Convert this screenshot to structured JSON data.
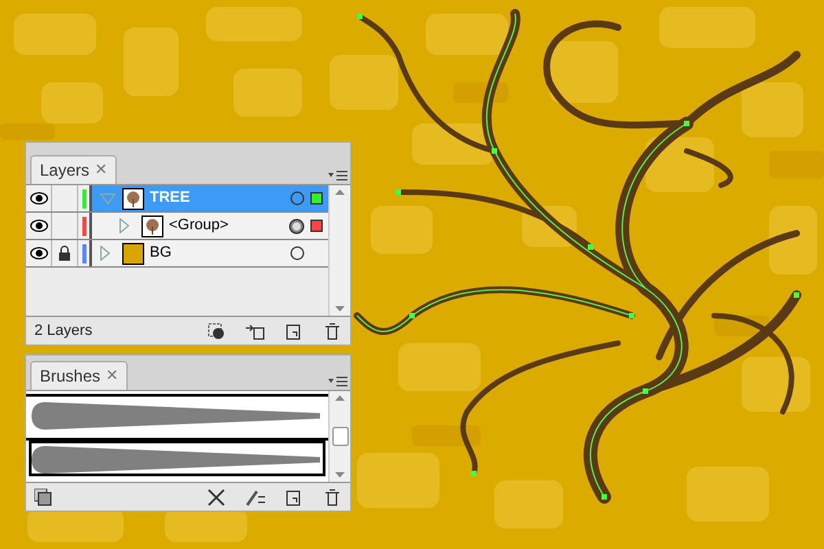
{
  "layers_panel": {
    "tab": "Layers",
    "tab_close": "✕",
    "layers": [
      {
        "name": "TREE",
        "visible": true,
        "locked": false,
        "color": "#33ee33",
        "selected": true,
        "expanded": true,
        "children": [
          {
            "name": "<Group>",
            "visible": true,
            "locked": false,
            "color": "#ff4444",
            "selected": false,
            "expanded": false
          }
        ]
      },
      {
        "name": "BG",
        "visible": true,
        "locked": true,
        "color": "#5588ff",
        "selected": false,
        "expanded": false
      }
    ],
    "status": "2 Layers"
  },
  "brushes_panel": {
    "tab": "Brushes",
    "tab_close": "✕",
    "brushes": [
      {
        "selected": false
      },
      {
        "selected": true
      }
    ]
  }
}
